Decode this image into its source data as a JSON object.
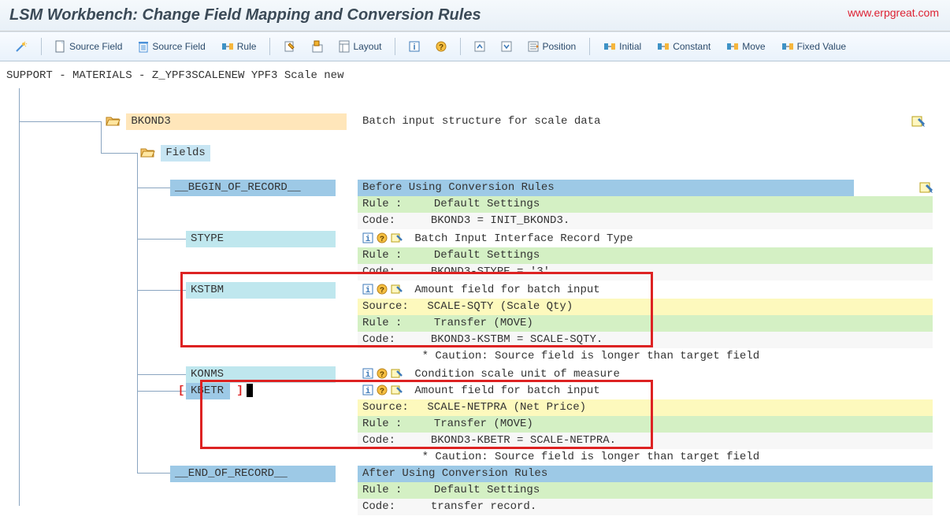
{
  "title": "LSM Workbench: Change Field Mapping and Conversion Rules",
  "url_label": "www.erpgreat.com",
  "toolbar": {
    "source_field_new": "Source Field",
    "source_field_del": "Source Field",
    "rule": "Rule",
    "layout": "Layout",
    "position": "Position",
    "initial": "Initial",
    "constant": "Constant",
    "move": "Move",
    "fixed_value": "Fixed Value"
  },
  "path": "SUPPORT - MATERIALS - Z_YPF3SCALENEW YPF3 Scale new",
  "tree": {
    "struct": "BKOND3",
    "struct_desc": "Batch input structure for scale data",
    "fields_label": "Fields",
    "begin": {
      "name": "__BEGIN_OF_RECORD__",
      "desc": "Before Using Conversion Rules",
      "rule_lbl": "Rule :",
      "rule_val": "Default Settings",
      "code_lbl": "Code:",
      "code_val": "BKOND3 = INIT_BKOND3."
    },
    "stype": {
      "name": "STYPE",
      "desc": "Batch Input Interface Record Type",
      "rule_lbl": "Rule :",
      "rule_val": "Default Settings",
      "code_lbl": "Code:",
      "code_val": "BKOND3-STYPE = '3'."
    },
    "kstbm": {
      "name": "KSTBM",
      "desc": "Amount field for batch input",
      "src_lbl": "Source:",
      "src_val": "SCALE-SQTY (Scale Qty)",
      "rule_lbl": "Rule :",
      "rule_val": "Transfer (MOVE)",
      "code_lbl": "Code:",
      "code_val": "BKOND3-KSTBM = SCALE-SQTY.",
      "caution": "* Caution: Source field is longer than target field"
    },
    "konms": {
      "name": "KONMS",
      "desc": "Condition scale unit of measure"
    },
    "kbetr": {
      "name": "KBETR",
      "desc": "Amount field for batch input",
      "src_lbl": "Source:",
      "src_val": "SCALE-NETPRA (Net Price)",
      "rule_lbl": "Rule :",
      "rule_val": "Transfer (MOVE)",
      "code_lbl": "Code:",
      "code_val": "BKOND3-KBETR = SCALE-NETPRA.",
      "caution": "* Caution: Source field is longer than target field"
    },
    "end": {
      "name": "__END_OF_RECORD__",
      "desc": "After Using Conversion Rules",
      "rule_lbl": "Rule :",
      "rule_val": "Default Settings",
      "code_lbl": "Code:",
      "code_val": "transfer record."
    }
  }
}
